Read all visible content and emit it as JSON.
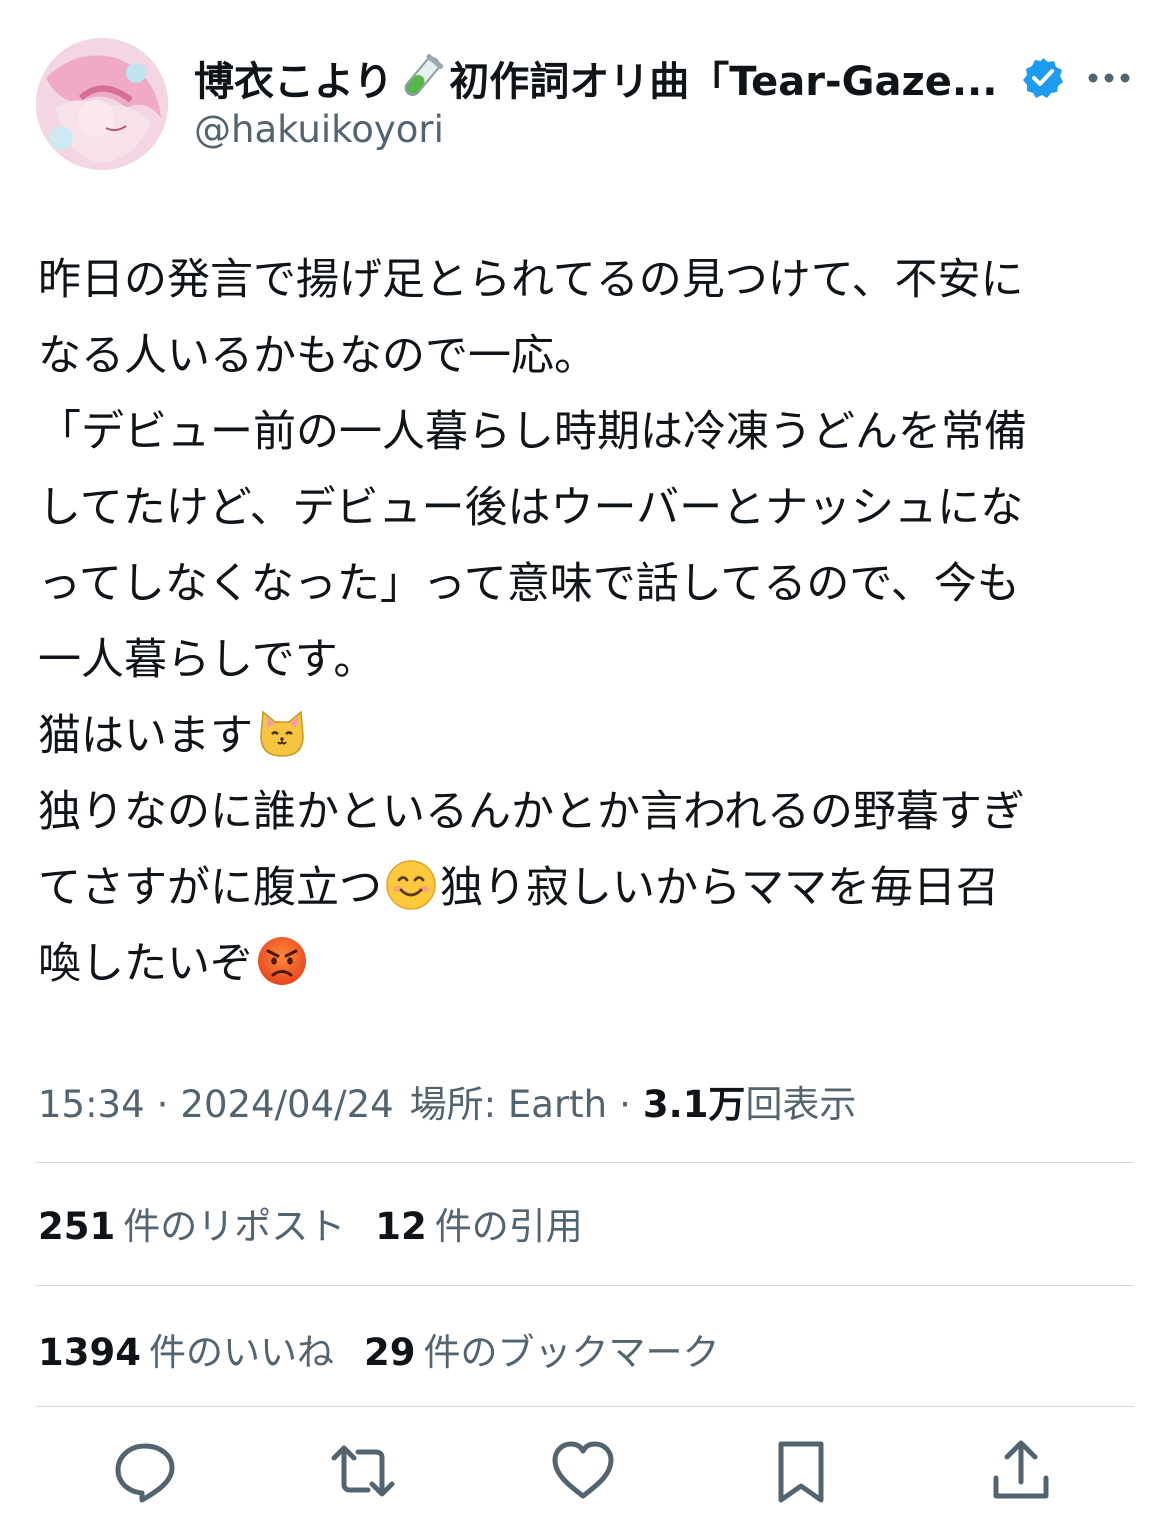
{
  "user": {
    "display_name_1": "博衣こより",
    "display_name_2": "初作詞オリ曲「Tear-Gaze...",
    "handle": "@hakuikoyori",
    "verified": true
  },
  "tweet": {
    "lines": [
      "昨日の発言で揚げ足とられてるの見つけて、不安に",
      "なる人いるかもなので一応。",
      "「デビュー前の一人暮らし時期は冷凍うどんを常備",
      "してたけど、デビュー後はウーバーとナッシュにな",
      "ってしなくなった」って意味で話してるので、今も",
      "一人暮らしです。",
      "猫はいます",
      "独りなのに誰かといるんかとか言われるの野暮すぎ",
      "てさすがに腹立つ",
      "独り寂しいからママを毎日召",
      "喚したいぞ"
    ]
  },
  "meta": {
    "time": "15:34",
    "date": "2024/04/24",
    "location": "場所: Earth",
    "views_count": "3.1万",
    "views_label": "回表示",
    "separator": "·"
  },
  "stats": {
    "reposts_count": "251",
    "reposts_label": "件のリポスト",
    "quotes_count": "12",
    "quotes_label": "件の引用",
    "likes_count": "1394",
    "likes_label": "件のいいね",
    "bookmarks_count": "29",
    "bookmarks_label": "件のブックマーク"
  },
  "colors": {
    "text": "#0f1419",
    "secondary": "#536471",
    "verified": "#1d9bf0",
    "divider": "#cfd9de"
  },
  "icons": [
    "test-tube-icon",
    "verified-badge-icon",
    "more-icon",
    "cat-face-emoji",
    "smiling-face-emoji",
    "angry-face-emoji",
    "reply-icon",
    "repost-icon",
    "like-icon",
    "bookmark-icon",
    "share-icon"
  ]
}
